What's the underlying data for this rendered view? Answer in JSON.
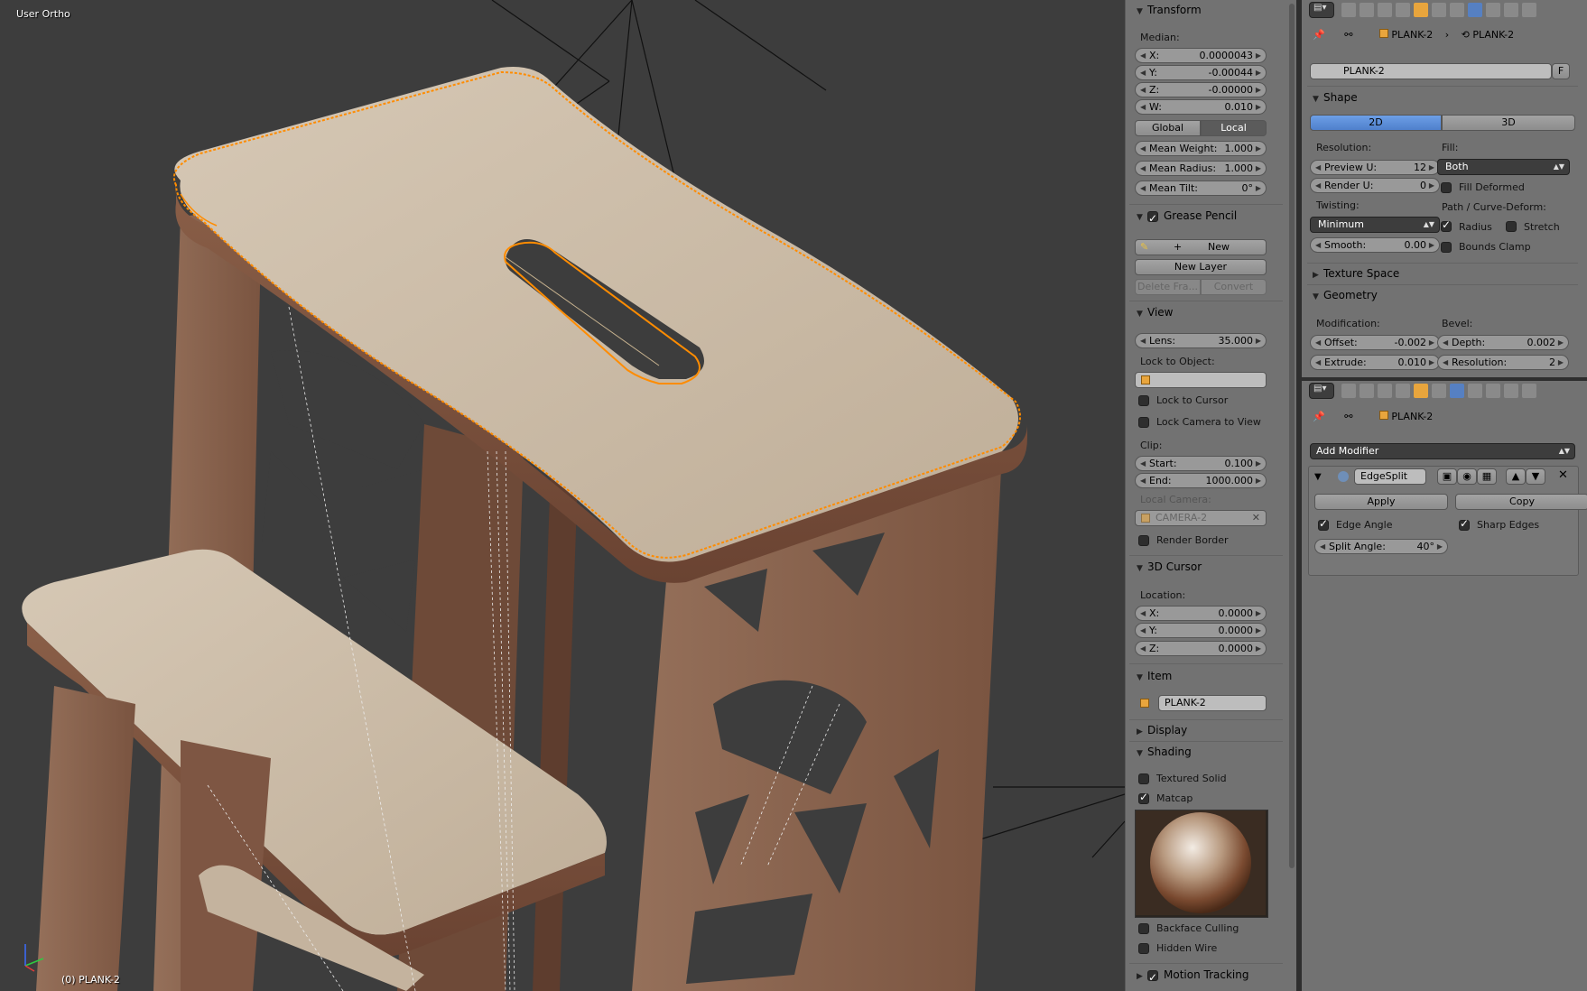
{
  "viewport": {
    "view_label": "User Ortho",
    "object_label": "(0) PLANK-2"
  },
  "npanel": {
    "transform": {
      "title": "Transform",
      "median_label": "Median:",
      "x": {
        "label": "X:",
        "value": "0.0000043"
      },
      "y": {
        "label": "Y:",
        "value": "-0.00044"
      },
      "z": {
        "label": "Z:",
        "value": "-0.00000"
      },
      "w": {
        "label": "W:",
        "value": "0.010"
      },
      "global_label": "Global",
      "local_label": "Local",
      "mean_weight": {
        "label": "Mean Weight:",
        "value": "1.000"
      },
      "mean_radius": {
        "label": "Mean Radius:",
        "value": "1.000"
      },
      "mean_tilt": {
        "label": "Mean Tilt:",
        "value": "0°"
      }
    },
    "grease_pencil": {
      "title": "Grease Pencil",
      "enabled": true,
      "new_label": "New",
      "new_layer_label": "New Layer",
      "delete_frame_label": "Delete Fra...",
      "convert_label": "Convert"
    },
    "view": {
      "title": "View",
      "lens": {
        "label": "Lens:",
        "value": "35.000"
      },
      "lock_to_object_label": "Lock to Object:",
      "lock_to_cursor_label": "Lock to Cursor",
      "lock_camera_label": "Lock Camera to View",
      "clip_label": "Clip:",
      "clip_start": {
        "label": "Start:",
        "value": "0.100"
      },
      "clip_end": {
        "label": "End:",
        "value": "1000.000"
      },
      "local_camera_label": "Local Camera:",
      "local_camera_value": "CAMERA-2",
      "render_border_label": "Render Border"
    },
    "cursor": {
      "title": "3D Cursor",
      "location_label": "Location:",
      "x": {
        "label": "X:",
        "value": "0.0000"
      },
      "y": {
        "label": "Y:",
        "value": "0.0000"
      },
      "z": {
        "label": "Z:",
        "value": "0.0000"
      }
    },
    "item": {
      "title": "Item",
      "name": "PLANK-2"
    },
    "display": {
      "title": "Display"
    },
    "shading": {
      "title": "Shading",
      "textured_solid_label": "Textured Solid",
      "textured_solid": false,
      "matcap_label": "Matcap",
      "matcap": true,
      "backface_culling_label": "Backface Culling",
      "hidden_wire_label": "Hidden Wire"
    },
    "motion_tracking": {
      "title": "Motion Tracking",
      "enabled": true
    }
  },
  "props_top": {
    "breadcrumb": [
      "PLANK-2",
      "PLANK-2"
    ],
    "datablock": "PLANK-2",
    "fake_user_label": "F",
    "shape": {
      "title": "Shape",
      "mode_2d": "2D",
      "mode_3d": "3D",
      "active_mode": "2D",
      "resolution_label": "Resolution:",
      "preview_u": {
        "label": "Preview U:",
        "value": "12"
      },
      "render_u": {
        "label": "Render U:",
        "value": "0"
      },
      "fill_label": "Fill:",
      "fill_value": "Both",
      "fill_deformed_label": "Fill Deformed",
      "twisting_label": "Twisting:",
      "twisting_value": "Minimum",
      "smooth": {
        "label": "Smooth:",
        "value": "0.00"
      },
      "path_label": "Path / Curve-Deform:",
      "radius_label": "Radius",
      "radius": true,
      "stretch_label": "Stretch",
      "bounds_clamp_label": "Bounds Clamp"
    },
    "texture_space": {
      "title": "Texture Space"
    },
    "geometry": {
      "title": "Geometry",
      "modification_label": "Modification:",
      "offset": {
        "label": "Offset:",
        "value": "-0.002"
      },
      "extrude": {
        "label": "Extrude:",
        "value": "0.010"
      },
      "bevel_label": "Bevel:",
      "depth": {
        "label": "Depth:",
        "value": "0.002"
      },
      "resolution": {
        "label": "Resolution:",
        "value": "2"
      }
    }
  },
  "props_bottom": {
    "breadcrumb": [
      "PLANK-2"
    ],
    "add_modifier_label": "Add Modifier",
    "modifier": {
      "name": "EdgeSplit",
      "apply_label": "Apply",
      "copy_label": "Copy",
      "edge_angle_label": "Edge Angle",
      "edge_angle": true,
      "sharp_edges_label": "Sharp Edges",
      "sharp_edges": true,
      "split_angle": {
        "label": "Split Angle:",
        "value": "40°"
      }
    }
  },
  "colors": {
    "viewport_bg": "#3d3d3d",
    "wood_light": "#c9b9a5",
    "wood_dark": "#7a5240",
    "selection_orange": "#ff8c00",
    "panel_bg": "#727272",
    "accent_blue": "#5680c2"
  }
}
